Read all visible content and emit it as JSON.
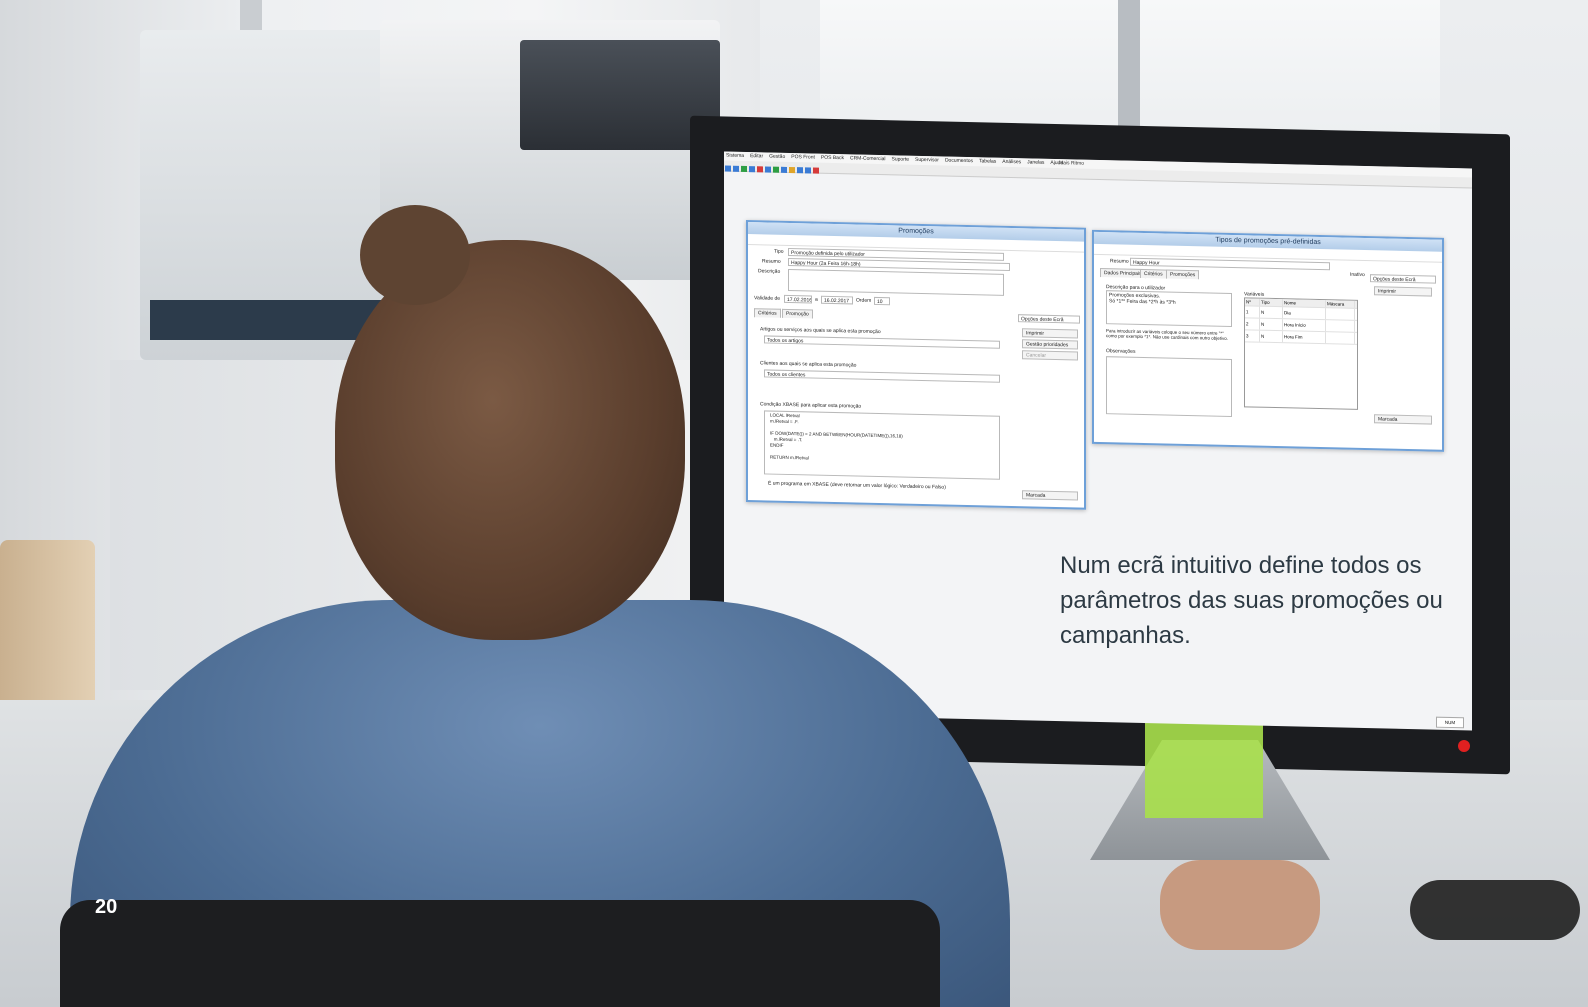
{
  "screen": {
    "app_title": "Mais Ritmo",
    "menu": [
      "Sistema",
      "Editar",
      "Gestão",
      "POS Front",
      "POS Back",
      "CRM-Comercial",
      "Suporte",
      "Supervisor",
      "Documentos",
      "Tabelas",
      "Análises",
      "Janelas",
      "Ajuda"
    ],
    "status": "NUM",
    "promocoes_window": {
      "title": "Promoções",
      "tipo_label": "Tipo",
      "tipo_value": "Promoção definida pelo utilizador",
      "resumo_label": "Resumo",
      "resumo_value": "Happy Hour (2a Feira 16h-18h)",
      "descricao_label": "Descrição",
      "validade_label": "Validade de",
      "validade_from": "17.02.2016",
      "validade_sep": "a",
      "validade_to": "16.02.2017",
      "ordem_label": "Ordem",
      "ordem_value": "10",
      "tabs": [
        "Critérios",
        "Promoção"
      ],
      "artigos_label": "Artigos ou serviços aos quais se aplica esta promoção",
      "artigos_value": "Todos os artigos",
      "clientes_label": "Clientes aos quais se aplica esta promoção",
      "clientes_value": "Todos os clientes",
      "condicao_label": "Condição XBASE para aplicar esta promoção",
      "code": "LOCAL lRetval\nm.lRetval = .F.\n\nIF DOW(DATE()) = 2 AND BETWEEN(HOUR(DATETIME()),16,18)\n   m.lRetval = .T.\nENDIF\n\nRETURN m.lRetval",
      "checkbox_label": "É um programa em XBASE (deve retornar um valor lógico: Verdadeiro ou Falso)",
      "opcoes_label": "Opções deste Ecrã",
      "btn_imprimir": "Imprimir",
      "btn_gestao": "Gestão prioridades",
      "btn_cancelar": "Cancelar",
      "btn_marcada": "Marcada"
    },
    "tipos_window": {
      "title": "Tipos de promoções pré-definidas",
      "resumo_label": "Resumo",
      "resumo_value": "Happy Hour",
      "inativo_label": "Inativo",
      "tabs": [
        "Dados Principais",
        "Critérios",
        "Promoções"
      ],
      "descricao_label": "Descrição para o utilizador",
      "descricao_value": "Promoções exclusivas.\nSó *1** Feira das *2*h às *3*h",
      "help_text": "Para introduzir as variáveis coloque o seu número entre \"*\" como por exemplo *1*. Não use cardinais com outro objetivo.",
      "observacoes_label": "Observações",
      "variaveis_label": "Variáveis",
      "columns": [
        "Nº",
        "Tipo",
        "Nome",
        "Máscara"
      ],
      "rows": [
        [
          "1",
          "N",
          "Dia",
          ""
        ],
        [
          "2",
          "N",
          "Hora Início",
          ""
        ],
        [
          "3",
          "N",
          "Hora Fim",
          ""
        ]
      ],
      "opcoes_label": "Opções deste Ecrã",
      "btn_imprimir": "Imprimir",
      "btn_marcada": "Marcada"
    }
  },
  "caption": "Num ecrã intuitivo define todos os parâmetros das suas promoções ou campanhas.",
  "page_number": "20"
}
